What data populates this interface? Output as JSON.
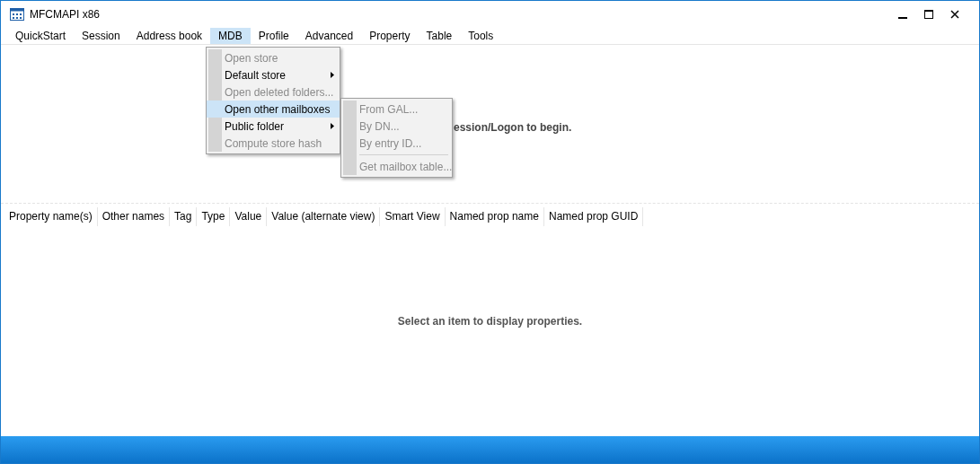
{
  "window": {
    "title": "MFCMAPI x86"
  },
  "menu_bar": [
    {
      "label": "QuickStart",
      "selected": false
    },
    {
      "label": "Session",
      "selected": false
    },
    {
      "label": "Address book",
      "selected": false
    },
    {
      "label": "MDB",
      "selected": true
    },
    {
      "label": "Profile",
      "selected": false
    },
    {
      "label": "Advanced",
      "selected": false
    },
    {
      "label": "Property",
      "selected": false
    },
    {
      "label": "Table",
      "selected": false
    },
    {
      "label": "Tools",
      "selected": false
    }
  ],
  "mdb_menu": [
    {
      "label": "Open store",
      "disabled": true,
      "submenu": false,
      "selected": false
    },
    {
      "label": "Default store",
      "disabled": false,
      "submenu": true,
      "selected": false
    },
    {
      "label": "Open deleted folders...",
      "disabled": true,
      "submenu": false,
      "selected": false
    },
    {
      "label": "Open other mailboxes",
      "disabled": false,
      "submenu": true,
      "selected": true
    },
    {
      "label": "Public folder",
      "disabled": false,
      "submenu": true,
      "selected": false
    },
    {
      "label": "Compute store hash",
      "disabled": true,
      "submenu": false,
      "selected": false
    }
  ],
  "submenu": [
    {
      "label": "From GAL...",
      "disabled": true,
      "separator_before": false
    },
    {
      "label": "By DN...",
      "disabled": true,
      "separator_before": false
    },
    {
      "label": "By entry ID...",
      "disabled": true,
      "separator_before": false
    },
    {
      "label": "Get mailbox table...",
      "disabled": true,
      "separator_before": true
    }
  ],
  "top_pane": {
    "message": "ession/Logon to begin."
  },
  "property_table": {
    "columns": [
      "Property name(s)",
      "Other names",
      "Tag",
      "Type",
      "Value",
      "Value (alternate view)",
      "Smart View",
      "Named prop name",
      "Named prop GUID"
    ],
    "message": "Select an item to display properties."
  }
}
